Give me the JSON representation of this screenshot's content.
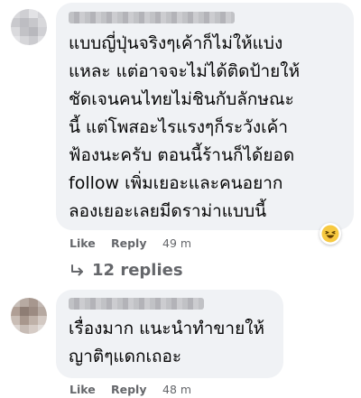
{
  "comments": [
    {
      "lines": [
        "แบบญี่ปุ่นจริงๆเค้าก็ไม่ให้แบ่ง",
        "แหละ แต่อาจจะไม่ได้ติดป้ายให้",
        "ชัดเจนคนไทยไม่ชินกับลักษณะ",
        "นี้ แต่โพสอะไรแรงๆก็ระวังเค้า",
        "ฟ้องนะครับ ตอนนี้ร้านก็ได้ยอด",
        "follow เพิ่มเยอะและคนอยาก",
        "ลองเยอะเลยมีดราม่าแบบนี้"
      ],
      "like_label": "Like",
      "reply_label": "Reply",
      "time": "49 m",
      "reaction_icon": "haha-reaction-icon",
      "replies_label": "12 replies"
    },
    {
      "lines": [
        "เรื่องมาก แนะนำทำขายให้",
        "ญาติๆแดกเถอะ"
      ],
      "like_label": "Like",
      "reply_label": "Reply",
      "time": "48 m"
    }
  ],
  "colors": {
    "bubble": "#f0f2f5",
    "text": "#050505",
    "meta": "#65676b"
  }
}
